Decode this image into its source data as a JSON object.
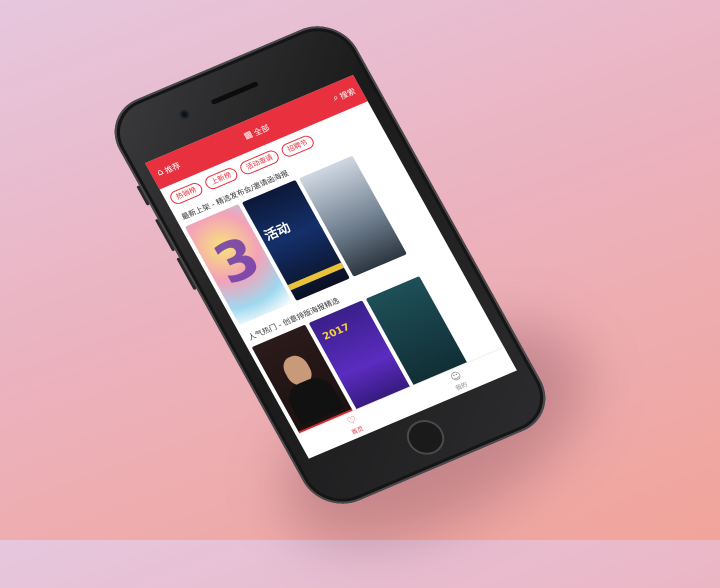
{
  "header": {
    "left_label": "推荐",
    "center_label": "全部",
    "right_label": "搜索"
  },
  "tags": [
    "热销榜",
    "上新榜",
    "活动邀请",
    "招聘节"
  ],
  "sections": [
    {
      "title": "最新上架 - 精选发布会/邀请函海报"
    },
    {
      "title": "人气热门 - 创意排版海报精选"
    }
  ],
  "cards": {
    "card_2_text": "活动",
    "card_5_text": "2017"
  },
  "tabbar": {
    "home_label": "首页",
    "mine_label": "我的"
  },
  "colors": {
    "accent": "#e8303e",
    "phone_body": "#1b1b1c"
  }
}
